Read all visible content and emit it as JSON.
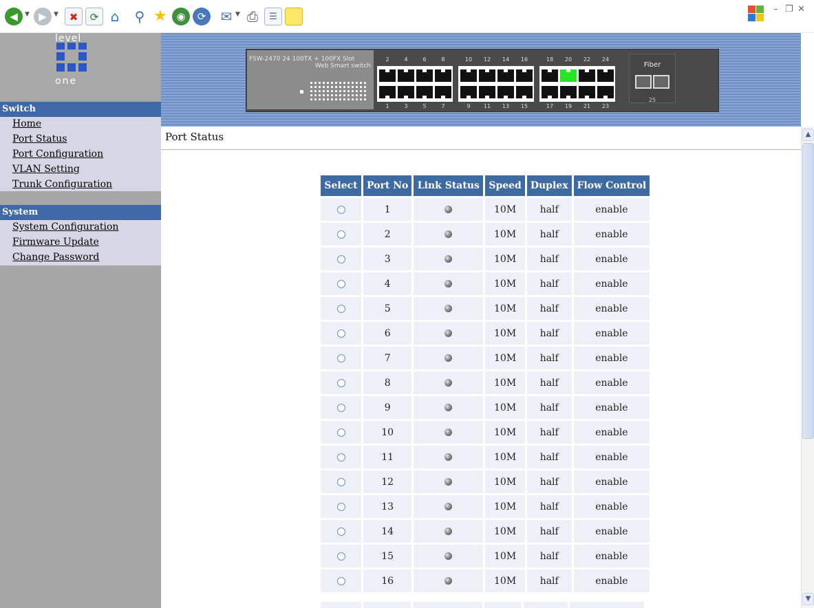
{
  "logo": {
    "top": "level",
    "bottom": "one"
  },
  "switch_panel": {
    "model": "FSW-2470  24 100TX + 100FX Slot",
    "subtitle": "Web Smart switch",
    "top_port_labels": [
      "2",
      "4",
      "6",
      "8",
      "10",
      "12",
      "14",
      "16",
      "18",
      "20",
      "22",
      "24"
    ],
    "bottom_port_labels": [
      "1",
      "3",
      "5",
      "7",
      "9",
      "11",
      "13",
      "15",
      "17",
      "19",
      "21",
      "23"
    ],
    "active_port": "20",
    "fiber_label": "Fiber",
    "fiber_port": "25"
  },
  "sidebar": {
    "switch_section": {
      "title": "Switch",
      "items": [
        "Home",
        "Port Status",
        "Port Configuration",
        "VLAN Setting",
        "Trunk Configuration"
      ]
    },
    "system_section": {
      "title": "System",
      "items": [
        "System Configuration",
        "Firmware Update",
        "Change Password"
      ]
    }
  },
  "page": {
    "title": "Port Status"
  },
  "port_table": {
    "headers": [
      "Select",
      "Port No",
      "Link Status",
      "Speed",
      "Duplex",
      "Flow Control"
    ],
    "rows": [
      {
        "port": "1",
        "speed": "10M",
        "duplex": "half",
        "flow": "enable"
      },
      {
        "port": "2",
        "speed": "10M",
        "duplex": "half",
        "flow": "enable"
      },
      {
        "port": "3",
        "speed": "10M",
        "duplex": "half",
        "flow": "enable"
      },
      {
        "port": "4",
        "speed": "10M",
        "duplex": "half",
        "flow": "enable"
      },
      {
        "port": "5",
        "speed": "10M",
        "duplex": "half",
        "flow": "enable"
      },
      {
        "port": "6",
        "speed": "10M",
        "duplex": "half",
        "flow": "enable"
      },
      {
        "port": "7",
        "speed": "10M",
        "duplex": "half",
        "flow": "enable"
      },
      {
        "port": "8",
        "speed": "10M",
        "duplex": "half",
        "flow": "enable"
      },
      {
        "port": "9",
        "speed": "10M",
        "duplex": "half",
        "flow": "enable"
      },
      {
        "port": "10",
        "speed": "10M",
        "duplex": "half",
        "flow": "enable"
      },
      {
        "port": "11",
        "speed": "10M",
        "duplex": "half",
        "flow": "enable"
      },
      {
        "port": "12",
        "speed": "10M",
        "duplex": "half",
        "flow": "enable"
      },
      {
        "port": "13",
        "speed": "10M",
        "duplex": "half",
        "flow": "enable"
      },
      {
        "port": "14",
        "speed": "10M",
        "duplex": "half",
        "flow": "enable"
      },
      {
        "port": "15",
        "speed": "10M",
        "duplex": "half",
        "flow": "enable"
      },
      {
        "port": "16",
        "speed": "10M",
        "duplex": "half",
        "flow": "enable"
      }
    ]
  },
  "colors": {
    "header_blue": "#3e6aa2",
    "sidebar_gray": "#a6a6a6",
    "link_led": "gray",
    "active_port_led": "#22e822"
  }
}
